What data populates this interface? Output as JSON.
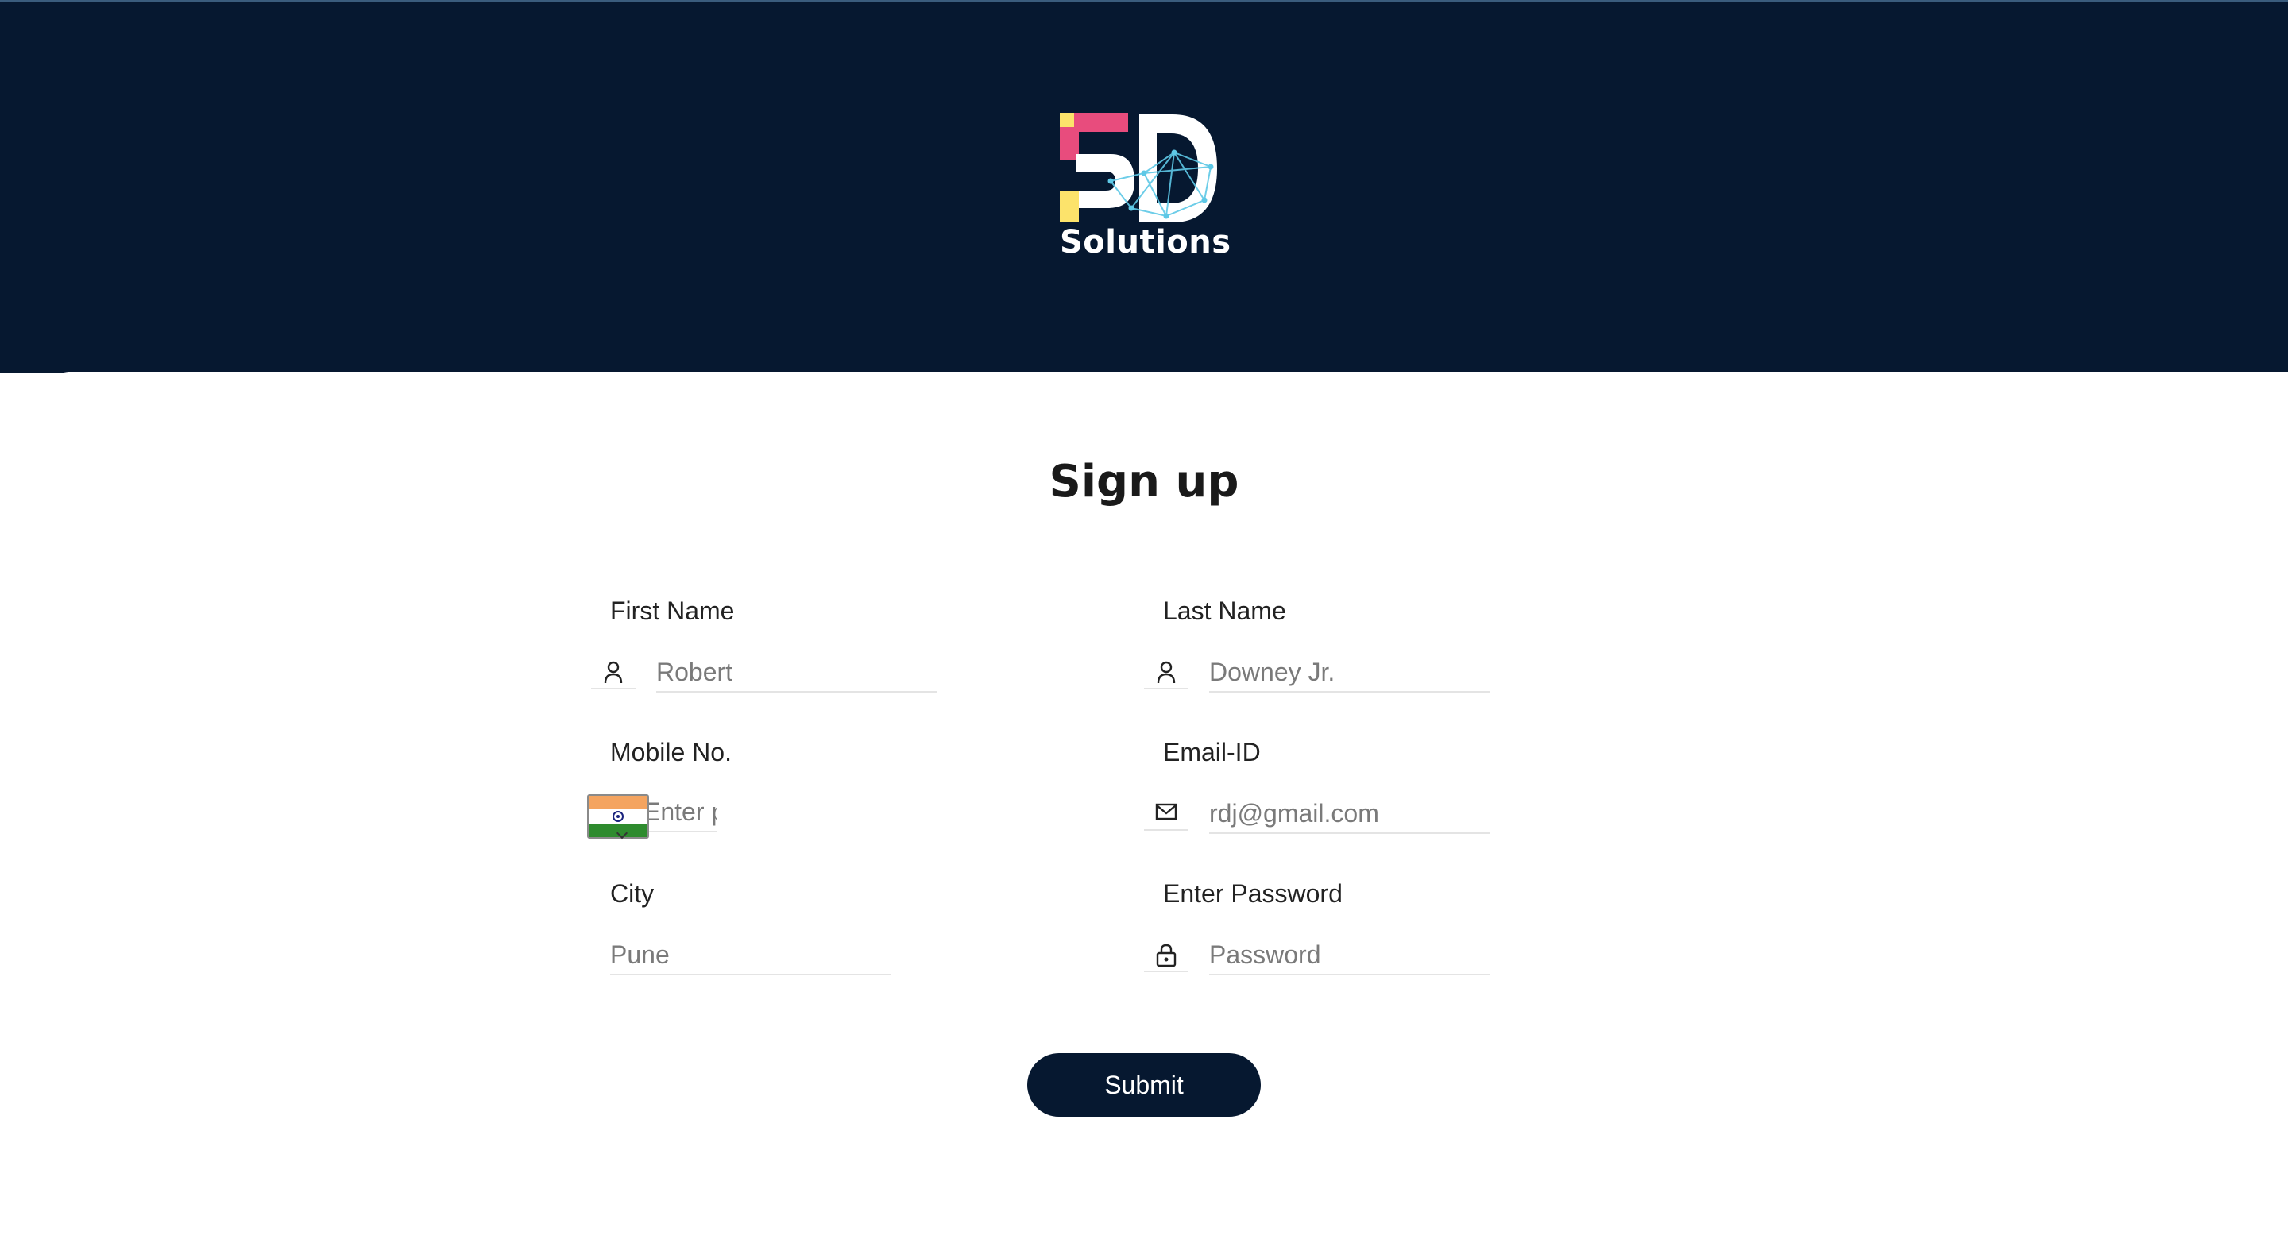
{
  "brand": {
    "name": "Solutions",
    "logo_icon": "5d-logo-icon",
    "colors": {
      "header_bg": "#061830",
      "logo_pink": "#e84c7d",
      "logo_yellow": "#fce36b",
      "logo_cyan": "#5ec8e6",
      "submit_bg": "#061830"
    }
  },
  "form": {
    "title": "Sign up",
    "first_name": {
      "label": "First Name",
      "placeholder": "Robert",
      "icon": "user-icon"
    },
    "last_name": {
      "label": "Last Name",
      "placeholder": "Downey Jr.",
      "icon": "user-icon"
    },
    "mobile": {
      "label": "Mobile No.",
      "placeholder": "Enter phone number",
      "country_flag": "india-flag-icon"
    },
    "email": {
      "label": "Email-ID",
      "placeholder": "rdj@gmail.com",
      "icon": "mail-icon"
    },
    "city": {
      "label": "City",
      "placeholder": "Pune"
    },
    "password": {
      "label": "Enter Password",
      "placeholder": "Password",
      "icon": "lock-icon"
    },
    "submit_label": "Submit"
  }
}
